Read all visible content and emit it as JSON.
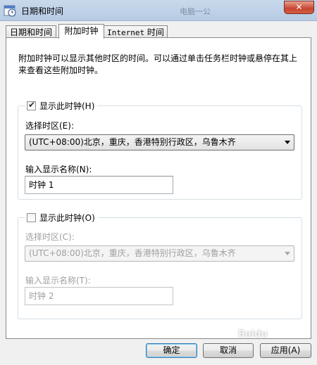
{
  "window": {
    "title": "日期和时间",
    "background_title": "电脑一公",
    "close_label": "✕"
  },
  "tabs": [
    {
      "label": "日期和时间",
      "active": false
    },
    {
      "label": "附加时钟",
      "active": true
    },
    {
      "label_mono": "Internet",
      "label_rest": " 时间",
      "active": false
    }
  ],
  "description": "附加时钟可以显示其他时区的时间。可以通过单击任务栏时钟或悬停在其上来查看这些附加时钟。",
  "clock1": {
    "show_label": "显示此时钟(H)",
    "checked": true,
    "timezone_label": "选择时区(E):",
    "timezone_value": "(UTC+08:00)北京，重庆，香港特别行政区，乌鲁木齐",
    "name_label": "输入显示名称(N):",
    "name_value": "时钟 1"
  },
  "clock2": {
    "show_label": "显示此时钟(O)",
    "checked": false,
    "timezone_label": "选择时区(C):",
    "timezone_value": "(UTC+08:00)北京，重庆，香港特别行政区，乌鲁木齐",
    "name_label": "输入显示名称(T):",
    "name_value": "时钟 2"
  },
  "buttons": {
    "ok": "确定",
    "cancel": "取消",
    "apply": "应用(A)"
  },
  "watermark": "Baidu"
}
